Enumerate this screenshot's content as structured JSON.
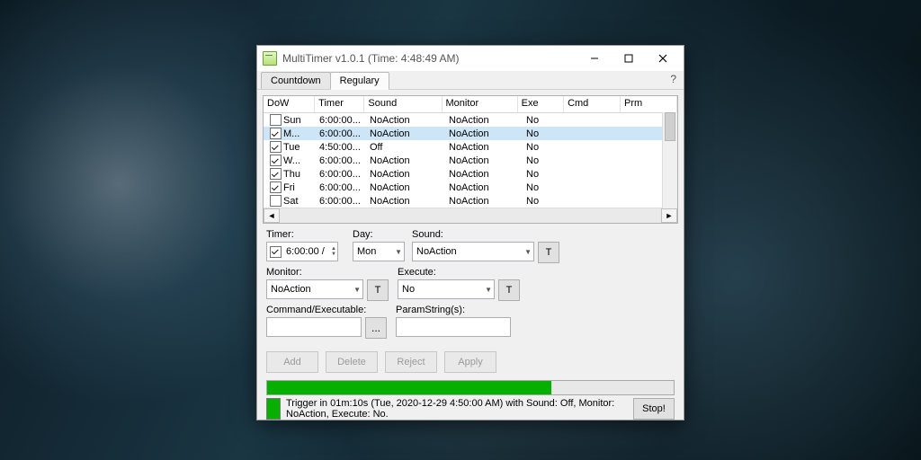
{
  "window": {
    "title": "MultiTimer v1.0.1 (Time: 4:48:49 AM)"
  },
  "tabs": {
    "countdown": "Countdown",
    "regulary": "Regulary"
  },
  "table": {
    "headers": {
      "dow": "DoW",
      "timer": "Timer",
      "sound": "Sound",
      "monitor": "Monitor",
      "exe": "Exe",
      "cmd": "Cmd",
      "prm": "Prm"
    },
    "rows": [
      {
        "check": false,
        "dow": "Sun",
        "timer": "6:00:00...",
        "sound": "NoAction",
        "monitor": "NoAction",
        "exe": "No"
      },
      {
        "check": true,
        "dow": "M...",
        "timer": "6:00:00...",
        "sound": "NoAction",
        "monitor": "NoAction",
        "exe": "No",
        "selected": true
      },
      {
        "check": true,
        "dow": "Tue",
        "timer": "4:50:00...",
        "sound": "Off",
        "monitor": "NoAction",
        "exe": "No"
      },
      {
        "check": true,
        "dow": "W...",
        "timer": "6:00:00...",
        "sound": "NoAction",
        "monitor": "NoAction",
        "exe": "No"
      },
      {
        "check": true,
        "dow": "Thu",
        "timer": "6:00:00...",
        "sound": "NoAction",
        "monitor": "NoAction",
        "exe": "No"
      },
      {
        "check": true,
        "dow": "Fri",
        "timer": "6:00:00...",
        "sound": "NoAction",
        "monitor": "NoAction",
        "exe": "No"
      },
      {
        "check": false,
        "dow": "Sat",
        "timer": "6:00:00...",
        "sound": "NoAction",
        "monitor": "NoAction",
        "exe": "No"
      }
    ]
  },
  "form": {
    "timer_label": "Timer:",
    "day_label": "Day:",
    "sound_label": "Sound:",
    "monitor_label": "Monitor:",
    "execute_label": "Execute:",
    "command_label": "Command/Executable:",
    "param_label": "ParamString(s):",
    "timer_value": "6:00:00 /",
    "day_value": "Mon",
    "sound_value": "NoAction",
    "monitor_value": "NoAction",
    "execute_value": "No",
    "t_label": "T",
    "browse_label": "..."
  },
  "actions": {
    "add": "Add",
    "delete": "Delete",
    "reject": "Reject",
    "apply": "Apply"
  },
  "status": {
    "message": "Trigger in 01m:10s (Tue, 2020-12-29 4:50:00 AM) with Sound: Off, Monitor: NoAction, Execute: No.",
    "stop": "Stop!"
  }
}
